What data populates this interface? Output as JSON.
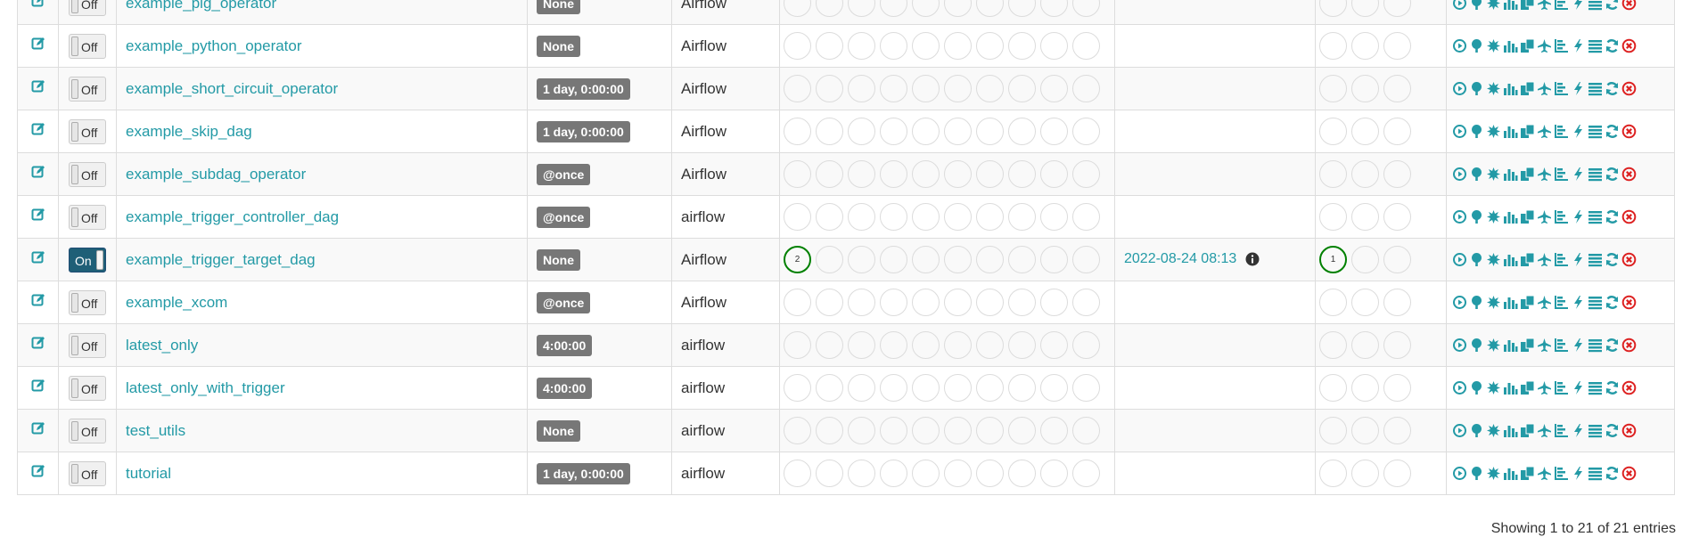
{
  "colors": {
    "link": "#239aa6",
    "badge_bg": "#777777",
    "active_circle": "#008000",
    "delete_icon": "#dd2222",
    "toggle_on_bg": "#1f5f77"
  },
  "table": {
    "rows": [
      {
        "dag_id": "example_pig_operator",
        "toggle": "Off",
        "is_on": false,
        "schedule": "None",
        "owner": "Airflow",
        "dag_runs": [],
        "last_run": "",
        "recent_tasks": []
      },
      {
        "dag_id": "example_python_operator",
        "toggle": "Off",
        "is_on": false,
        "schedule": "None",
        "owner": "Airflow",
        "dag_runs": [],
        "last_run": "",
        "recent_tasks": []
      },
      {
        "dag_id": "example_short_circuit_operator",
        "toggle": "Off",
        "is_on": false,
        "schedule": "1 day, 0:00:00",
        "owner": "Airflow",
        "dag_runs": [],
        "last_run": "",
        "recent_tasks": []
      },
      {
        "dag_id": "example_skip_dag",
        "toggle": "Off",
        "is_on": false,
        "schedule": "1 day, 0:00:00",
        "owner": "Airflow",
        "dag_runs": [],
        "last_run": "",
        "recent_tasks": []
      },
      {
        "dag_id": "example_subdag_operator",
        "toggle": "Off",
        "is_on": false,
        "schedule": "@once",
        "owner": "Airflow",
        "dag_runs": [],
        "last_run": "",
        "recent_tasks": []
      },
      {
        "dag_id": "example_trigger_controller_dag",
        "toggle": "Off",
        "is_on": false,
        "schedule": "@once",
        "owner": "airflow",
        "dag_runs": [],
        "last_run": "",
        "recent_tasks": []
      },
      {
        "dag_id": "example_trigger_target_dag",
        "toggle": "On",
        "is_on": true,
        "schedule": "None",
        "owner": "Airflow",
        "dag_runs": [
          "2"
        ],
        "last_run": "2022-08-24 08:13",
        "recent_tasks": [
          "1"
        ]
      },
      {
        "dag_id": "example_xcom",
        "toggle": "Off",
        "is_on": false,
        "schedule": "@once",
        "owner": "Airflow",
        "dag_runs": [],
        "last_run": "",
        "recent_tasks": []
      },
      {
        "dag_id": "latest_only",
        "toggle": "Off",
        "is_on": false,
        "schedule": "4:00:00",
        "owner": "airflow",
        "dag_runs": [],
        "last_run": "",
        "recent_tasks": []
      },
      {
        "dag_id": "latest_only_with_trigger",
        "toggle": "Off",
        "is_on": false,
        "schedule": "4:00:00",
        "owner": "airflow",
        "dag_runs": [],
        "last_run": "",
        "recent_tasks": []
      },
      {
        "dag_id": "test_utils",
        "toggle": "Off",
        "is_on": false,
        "schedule": "None",
        "owner": "airflow",
        "dag_runs": [],
        "last_run": "",
        "recent_tasks": []
      },
      {
        "dag_id": "tutorial",
        "toggle": "Off",
        "is_on": false,
        "schedule": "1 day, 0:00:00",
        "owner": "airflow",
        "dag_runs": [],
        "last_run": "",
        "recent_tasks": []
      }
    ],
    "link_icons": [
      {
        "name": "trigger-dag-icon",
        "glyph": "play"
      },
      {
        "name": "tree-view-icon",
        "glyph": "tree"
      },
      {
        "name": "graph-view-icon",
        "glyph": "burst"
      },
      {
        "name": "task-duration-icon",
        "glyph": "bars"
      },
      {
        "name": "task-tries-icon",
        "glyph": "duplicate"
      },
      {
        "name": "landing-times-icon",
        "glyph": "plane"
      },
      {
        "name": "gantt-icon",
        "glyph": "gantt"
      },
      {
        "name": "code-view-icon",
        "glyph": "flash"
      },
      {
        "name": "logs-icon",
        "glyph": "list"
      },
      {
        "name": "refresh-icon",
        "glyph": "refresh"
      },
      {
        "name": "delete-dag-icon",
        "glyph": "remove"
      }
    ]
  },
  "footer": {
    "info": "Showing 1 to 21 of 21 entries"
  }
}
